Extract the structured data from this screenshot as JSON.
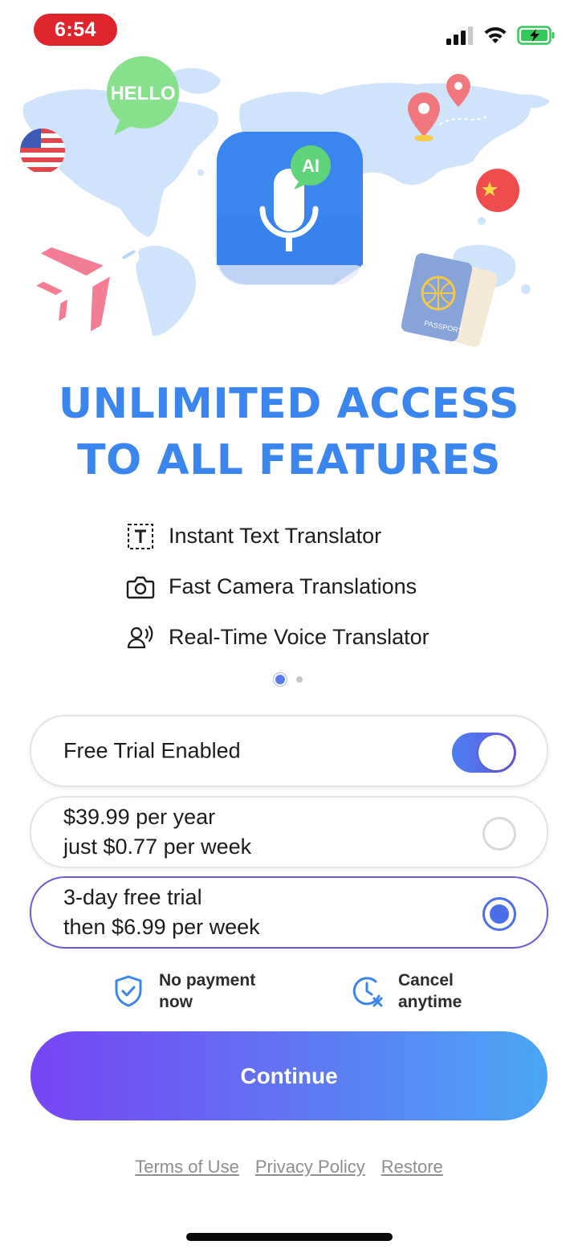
{
  "status_bar": {
    "time": "6:54"
  },
  "hero": {
    "bubble_text": "HELLO",
    "ai_badge": "AI",
    "passport_text": "PASSPORT"
  },
  "headline": {
    "line1": "UNLIMITED ACCESS",
    "line2": "TO ALL FEATURES"
  },
  "features": [
    {
      "icon": "text-box-icon",
      "label": "Instant Text Translator"
    },
    {
      "icon": "camera-icon",
      "label": "Fast Camera Translations"
    },
    {
      "icon": "voice-person-icon",
      "label": "Real-Time Voice Translator"
    }
  ],
  "pagination": {
    "total": 2,
    "active": 1
  },
  "options": {
    "free_trial_toggle": {
      "label": "Free Trial Enabled",
      "enabled": true
    },
    "yearly": {
      "line1": "$39.99 per year",
      "line2": "just $0.77 per week",
      "selected": false
    },
    "weekly": {
      "line1": "3-day free trial",
      "line2": "then $6.99 per week",
      "selected": true
    }
  },
  "assurances": {
    "no_payment": {
      "line1": "No payment",
      "line2": "now",
      "icon": "shield-check-icon"
    },
    "cancel": {
      "line1": "Cancel",
      "line2": "anytime",
      "icon": "clock-cancel-icon"
    }
  },
  "continue_label": "Continue",
  "links": {
    "terms": "Terms of Use",
    "privacy": "Privacy Policy",
    "restore": "Restore"
  },
  "colors": {
    "accent": "#3a86ee",
    "button_start": "#7845f5",
    "button_end": "#4aa6f5",
    "time_pill": "#e0242e",
    "selected_border": "#6b5bd6"
  }
}
